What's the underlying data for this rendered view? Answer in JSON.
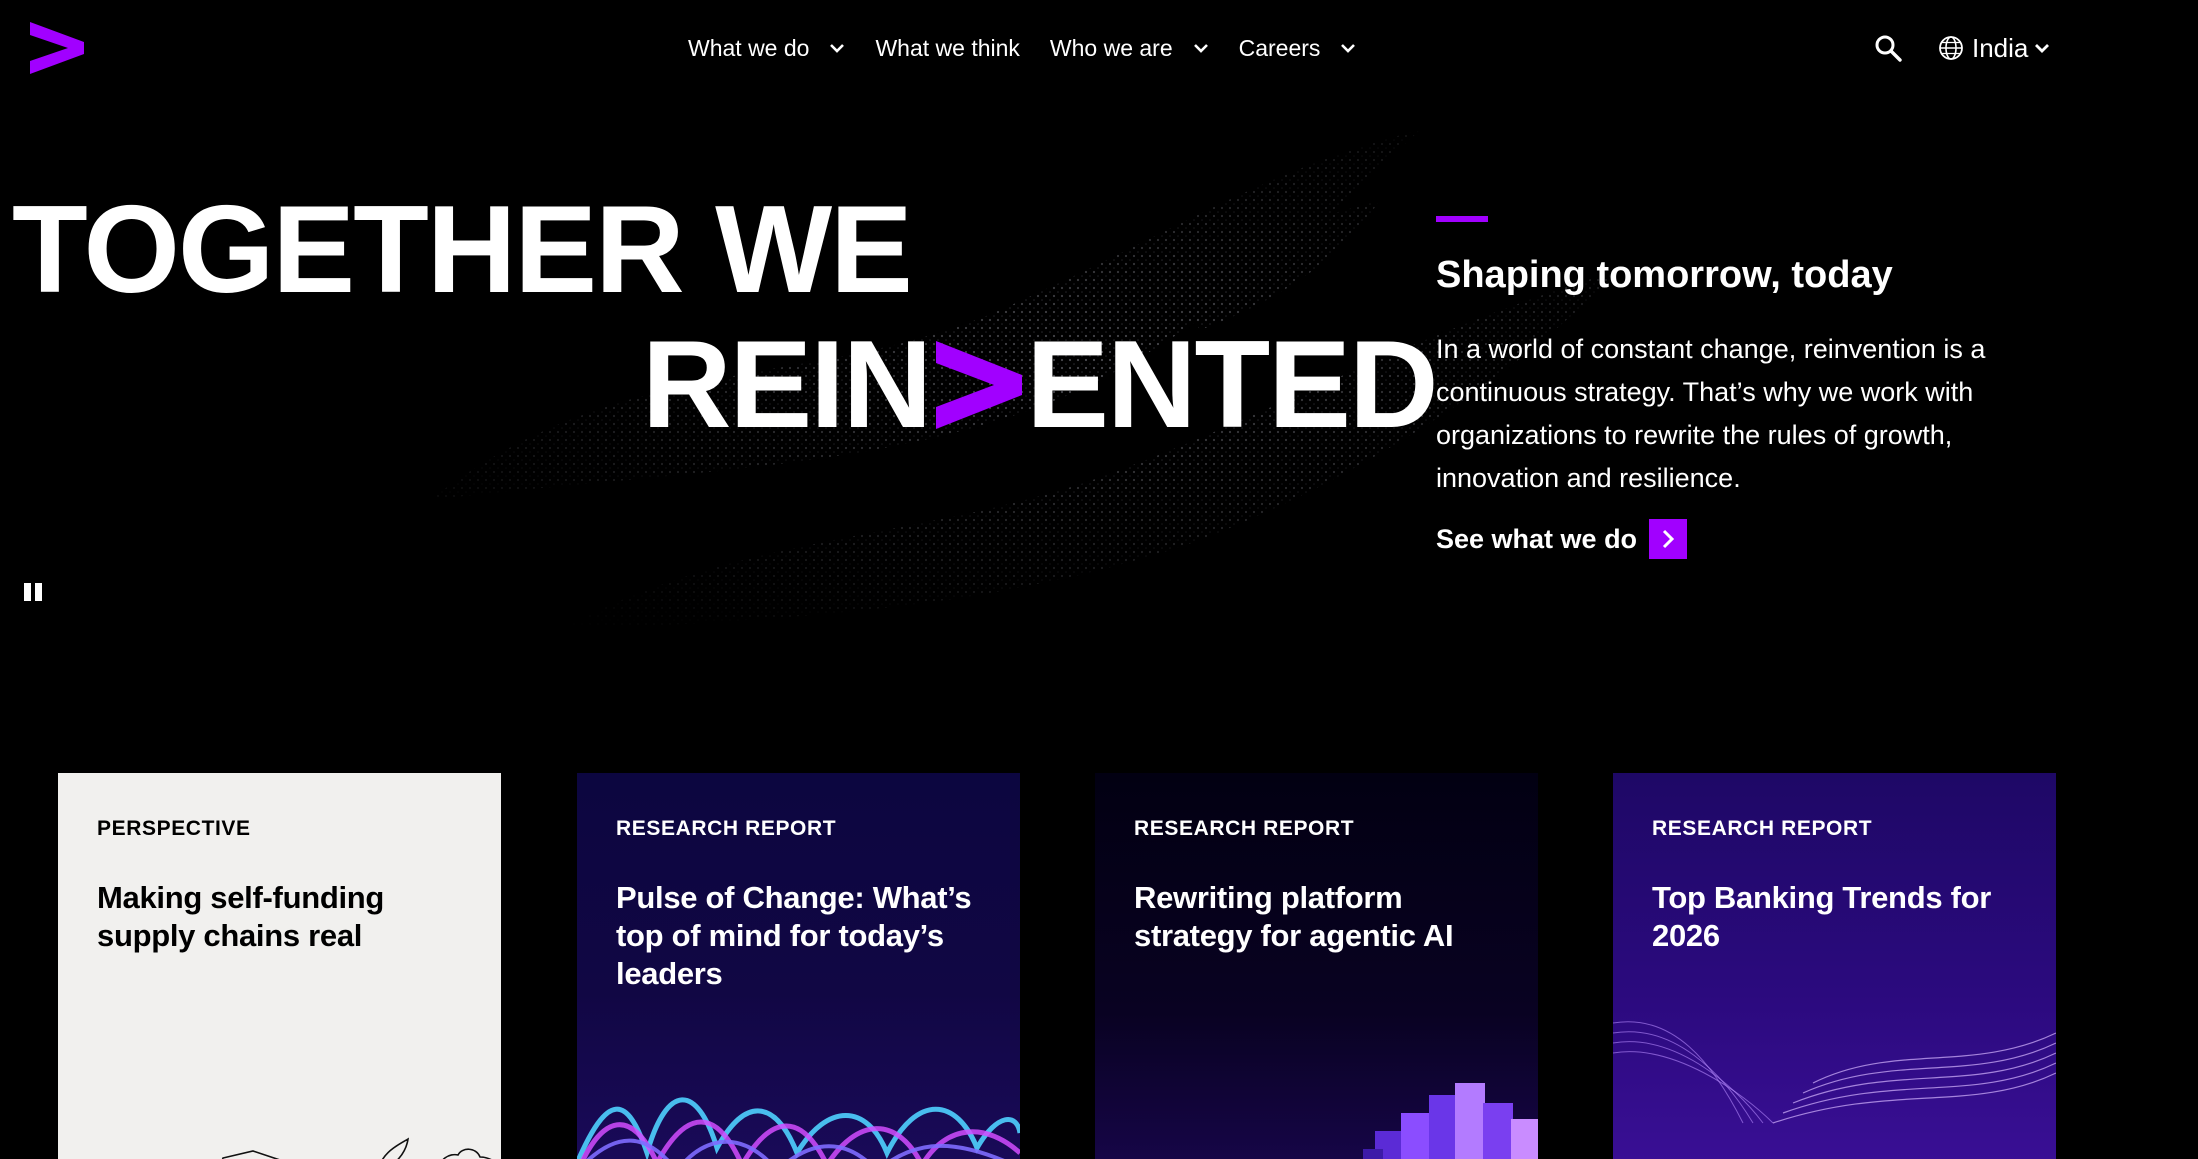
{
  "brand": {
    "accent": "#a100ff",
    "logo_icon": "accenture-greater-than-icon"
  },
  "nav": {
    "items": [
      {
        "label": "What we do",
        "has_dropdown": true
      },
      {
        "label": "What we think",
        "has_dropdown": false
      },
      {
        "label": "Who we are",
        "has_dropdown": true
      },
      {
        "label": "Careers",
        "has_dropdown": true
      }
    ]
  },
  "header": {
    "search_icon": "search-icon",
    "locale": {
      "icon": "globe-icon",
      "label": "India"
    }
  },
  "hero": {
    "headline_line1": "TOGETHER WE",
    "headline_line2_start": "REIN",
    "headline_line2_end": "ENTED",
    "subtitle": "Shaping tomorrow, today",
    "description": "In a world of constant change, reinvention is a continuous strategy. That’s why we work with organizations to rewrite the rules of growth, innovation and resilience.",
    "cta_label": "See what we do",
    "pause_icon": "pause-icon"
  },
  "cards": [
    {
      "category": "PERSPECTIVE",
      "title": "Making self-funding supply chains real"
    },
    {
      "category": "RESEARCH REPORT",
      "title": "Pulse of Change: What’s top of mind for today’s leaders"
    },
    {
      "category": "RESEARCH REPORT",
      "title": "Rewriting platform strategy for agentic AI"
    },
    {
      "category": "RESEARCH REPORT",
      "title": "Top Banking Trends for 2026"
    }
  ]
}
